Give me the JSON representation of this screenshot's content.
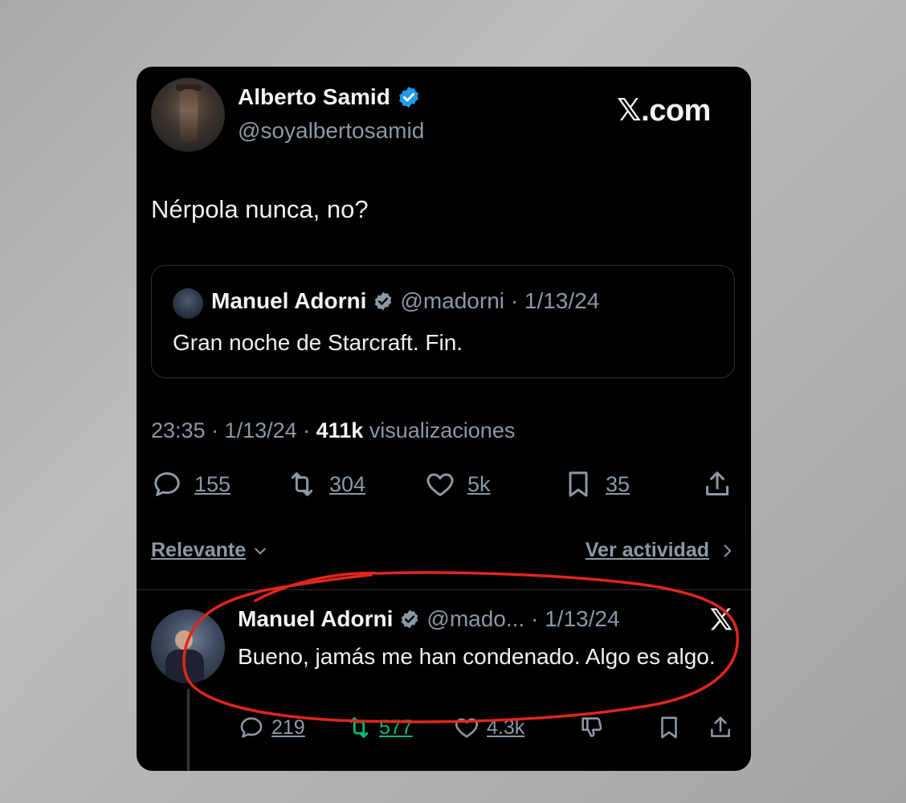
{
  "post": {
    "author_name": "Alberto Samid",
    "author_handle": "@soyalbertosamid",
    "brand": "com",
    "text": "Nérpola nunca, no?",
    "quoted": {
      "author_name": "Manuel Adorni",
      "meta": "@madorni · 1/13/24",
      "text": "Gran noche de Starcraft. Fin."
    },
    "time_date": "23:35 · 1/13/24 ·",
    "views_count": "411k",
    "views_label": "visualizaciones",
    "stats": {
      "replies": "155",
      "reposts": "304",
      "likes": "5k",
      "bookmarks": "35"
    }
  },
  "sort": {
    "label": "Relevante",
    "activity_link": "Ver actividad"
  },
  "reply": {
    "author_name": "Manuel Adorni",
    "meta": "@mado... · 1/13/24",
    "text": "Bueno, jamás me han condenado. Algo es algo.",
    "stats": {
      "replies": "219",
      "reposts": "577",
      "likes": "4.3k"
    }
  },
  "colors": {
    "card_bg": "#000000",
    "verified": "#1d9bf0",
    "muted": "#8b98a5",
    "repost_active": "#00ba7c",
    "annotation": "#e0261c"
  }
}
